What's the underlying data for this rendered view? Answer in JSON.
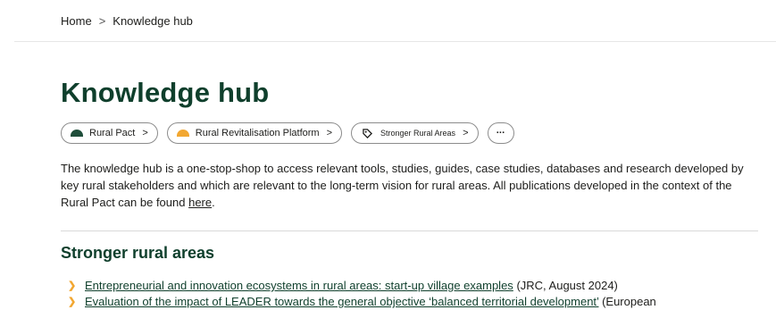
{
  "breadcrumb": {
    "home": "Home",
    "separator": ">",
    "current": "Knowledge hub"
  },
  "page_title": "Knowledge hub",
  "pills": [
    {
      "label": "Rural Pact",
      "icon": "half-circle-green-icon",
      "chevron": ">"
    },
    {
      "label": "Rural Revitalisation Platform",
      "icon": "half-circle-orange-icon",
      "chevron": ">"
    },
    {
      "label": "Stronger Rural Areas",
      "icon": "tag-icon",
      "chevron": ">"
    },
    {
      "label": "···",
      "icon": "more-icon"
    }
  ],
  "intro": {
    "text_before_link": "The knowledge hub is a one-stop-shop to access relevant tools, studies, guides, case studies, databases and research developed by key rural stakeholders and which are relevant to the long-term vision for rural areas. All publications developed in the context of the Rural Pact can be found ",
    "link_text": "here",
    "text_after_link": "."
  },
  "section": {
    "title": "Stronger rural areas",
    "items": [
      {
        "title": "Entrepreneurial and innovation ecosystems in rural areas: start-up village examples",
        "source": "(JRC, August 2024)"
      },
      {
        "title": "Evaluation of the impact of LEADER towards the general objective ‘balanced territorial development’",
        "source": "(European"
      }
    ]
  },
  "colors": {
    "brand_dark_green": "#0f3f2c",
    "accent_orange": "#f2a731",
    "pill_green": "#1f4e3a"
  }
}
